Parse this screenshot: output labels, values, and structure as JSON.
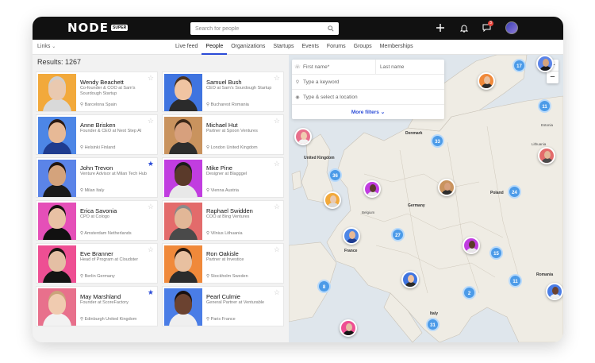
{
  "topbar": {
    "logo": "NODE",
    "logo_badge": "SUPER",
    "search_placeholder": "Search for people",
    "notification_count": "3"
  },
  "nav": {
    "links_label": "Links",
    "tabs": [
      "Live feed",
      "People",
      "Organizations",
      "Startups",
      "Events",
      "Forums",
      "Groups",
      "Memberships"
    ],
    "active_tab": "People"
  },
  "results_label": "Results: 1267",
  "people": [
    {
      "name": "Wendy Beachett",
      "role": "Co-founder & COO at Sam's Sourdough Startup",
      "location": "Barcelona Spain",
      "starred": false,
      "bg": "#f2a93b",
      "skin": "#e9c9b0",
      "shirt": "#d9d9d9",
      "hair": "#cfcfcf"
    },
    {
      "name": "Samuel Bush",
      "role": "CEO at Sam's Sourdough Startup",
      "location": "Bucharest Romania",
      "starred": false,
      "bg": "#3f74e0",
      "skin": "#f0c4a2",
      "shirt": "#2b2b2b",
      "hair": "#4a3220"
    },
    {
      "name": "Anne Brisken",
      "role": "Founder & CEO at Next Step AI",
      "location": "Helsinki Finland",
      "starred": false,
      "bg": "#4d86e6",
      "skin": "#e7b996",
      "shirt": "#1f3c8f",
      "hair": "#2b1a12"
    },
    {
      "name": "Michael Hut",
      "role": "Partner at Spoon Ventures",
      "location": "London United Kingdom",
      "starred": false,
      "bg": "#c9935e",
      "skin": "#d7a07d",
      "shirt": "#2d2d2d",
      "hair": "#3b2718"
    },
    {
      "name": "John Trevon",
      "role": "Venture Advisor at Milan Tech Hub",
      "location": "Milan Italy",
      "starred": true,
      "bg": "#5b84e8",
      "skin": "#d4a37c",
      "shirt": "#1b1b1b",
      "hair": "#221510"
    },
    {
      "name": "Mike Pine",
      "role": "Designer at Blagggel",
      "location": "Vienna Austria",
      "starred": false,
      "bg": "#c13de0",
      "skin": "#5a3a2a",
      "shirt": "#e8e8e8",
      "hair": "#1c1c1c"
    },
    {
      "name": "Erica Savonia",
      "role": "CPO at Cologo",
      "location": "Amsterdam Netherlands",
      "starred": false,
      "bg": "#e54fb8",
      "skin": "#e8c1a4",
      "shirt": "#111111",
      "hair": "#181010"
    },
    {
      "name": "Raphael Swidden",
      "role": "COO at Bing Ventures",
      "location": "Vilnius Lithuania",
      "starred": false,
      "bg": "#e36b6b",
      "skin": "#e2b797",
      "shirt": "#4a4a4a",
      "hair": "#8a8a8a"
    },
    {
      "name": "Eve Branner",
      "role": "Head of Program at Cloudster",
      "location": "Berlin Germany",
      "starred": false,
      "bg": "#ee4f93",
      "skin": "#e4bfa4",
      "shirt": "#141414",
      "hair": "#1a1410"
    },
    {
      "name": "Ron Oakisle",
      "role": "Partner at Investice",
      "location": "Stockholm Sweden",
      "starred": false,
      "bg": "#f0893a",
      "skin": "#e8c0a0",
      "shirt": "#2c2c2c",
      "hair": "#2a1a10"
    },
    {
      "name": "May Marshland",
      "role": "Founder at ScoreFactory",
      "location": "Edinburgh United Kingdom",
      "starred": true,
      "bg": "#e8708c",
      "skin": "#f0cbb0",
      "shirt": "#f2f2f2",
      "hair": "#caa37a"
    },
    {
      "name": "Pearl Culmie",
      "role": "General Partner at Venturable",
      "location": "Paris France",
      "starred": false,
      "bg": "#4a7de6",
      "skin": "#6b4230",
      "shirt": "#efefef",
      "hair": "#181010"
    }
  ],
  "filters": {
    "first_name": "First name*",
    "last_name": "Last name",
    "keyword": "Type a keyword",
    "location": "Type & select a location",
    "more": "More filters"
  },
  "map": {
    "clusters": [
      "17",
      "11",
      "33",
      "36",
      "24",
      "27",
      "15",
      "8",
      "2",
      "11",
      "31"
    ],
    "labels": [
      "Denmark",
      "United Kingdom",
      "Poland",
      "Germany",
      "France",
      "Romania",
      "Italy",
      "Belgium",
      "Estonia",
      "Lithuania"
    ],
    "zoom_in": "+",
    "zoom_out": "−"
  },
  "colors": {
    "accent": "#2a4bd7",
    "cluster": "#4c9be8",
    "topbar": "#111111"
  }
}
